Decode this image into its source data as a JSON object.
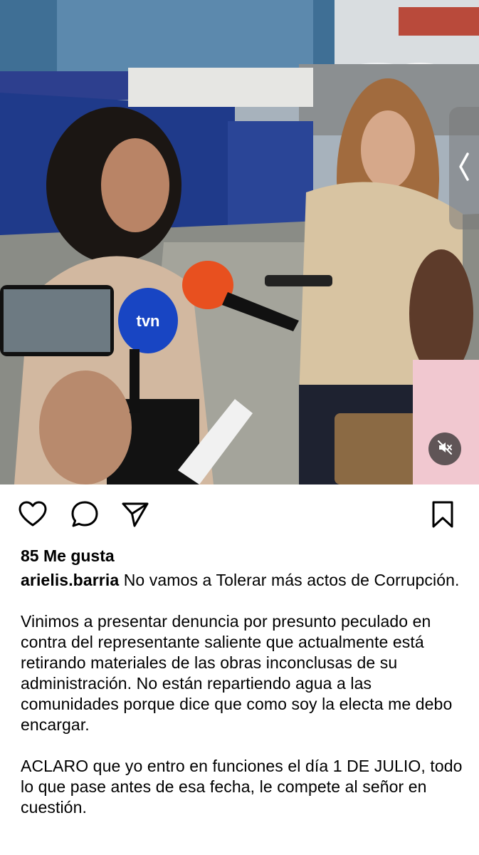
{
  "post": {
    "icons": {
      "like": "heart-icon",
      "comment": "comment-bubble-icon",
      "share": "send-paper-plane-icon",
      "save": "bookmark-icon",
      "mute": "speaker-muted-icon",
      "side_tab": "chevron-left-icon"
    },
    "media_overlay": {
      "mic_brand": "tvn"
    },
    "likes_text": "85 Me gusta",
    "caption": {
      "username": "arielis.barria",
      "first_line": "No vamos a Tolerar más actos de Corrupción.",
      "paragraph_2": "Vinimos a presentar denuncia por presunto peculado en contra del representante saliente que actualmente está retirando materiales de las obras inconclusas de su administración. No están repartiendo agua a las comunidades porque dice que como soy la electa me debo encargar.",
      "paragraph_3": "ACLARO que yo entro en funciones el día 1 DE JULIO, todo lo que pase antes de esa fecha, le compete al señor en cuestión."
    }
  }
}
